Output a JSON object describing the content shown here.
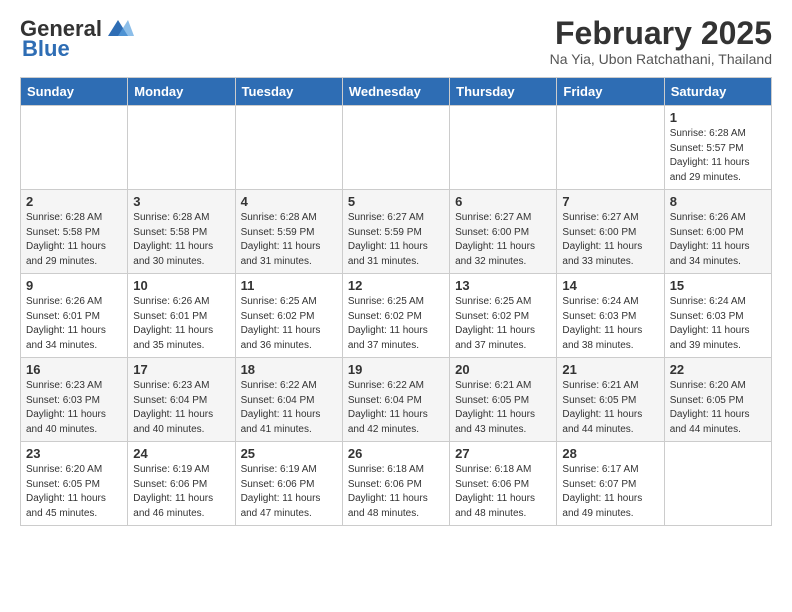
{
  "header": {
    "logo_general": "General",
    "logo_blue": "Blue",
    "month_title": "February 2025",
    "location": "Na Yia, Ubon Ratchathani, Thailand"
  },
  "weekdays": [
    "Sunday",
    "Monday",
    "Tuesday",
    "Wednesday",
    "Thursday",
    "Friday",
    "Saturday"
  ],
  "weeks": [
    [
      {
        "day": "",
        "info": ""
      },
      {
        "day": "",
        "info": ""
      },
      {
        "day": "",
        "info": ""
      },
      {
        "day": "",
        "info": ""
      },
      {
        "day": "",
        "info": ""
      },
      {
        "day": "",
        "info": ""
      },
      {
        "day": "1",
        "info": "Sunrise: 6:28 AM\nSunset: 5:57 PM\nDaylight: 11 hours and 29 minutes."
      }
    ],
    [
      {
        "day": "2",
        "info": "Sunrise: 6:28 AM\nSunset: 5:58 PM\nDaylight: 11 hours and 29 minutes."
      },
      {
        "day": "3",
        "info": "Sunrise: 6:28 AM\nSunset: 5:58 PM\nDaylight: 11 hours and 30 minutes."
      },
      {
        "day": "4",
        "info": "Sunrise: 6:28 AM\nSunset: 5:59 PM\nDaylight: 11 hours and 31 minutes."
      },
      {
        "day": "5",
        "info": "Sunrise: 6:27 AM\nSunset: 5:59 PM\nDaylight: 11 hours and 31 minutes."
      },
      {
        "day": "6",
        "info": "Sunrise: 6:27 AM\nSunset: 6:00 PM\nDaylight: 11 hours and 32 minutes."
      },
      {
        "day": "7",
        "info": "Sunrise: 6:27 AM\nSunset: 6:00 PM\nDaylight: 11 hours and 33 minutes."
      },
      {
        "day": "8",
        "info": "Sunrise: 6:26 AM\nSunset: 6:00 PM\nDaylight: 11 hours and 34 minutes."
      }
    ],
    [
      {
        "day": "9",
        "info": "Sunrise: 6:26 AM\nSunset: 6:01 PM\nDaylight: 11 hours and 34 minutes."
      },
      {
        "day": "10",
        "info": "Sunrise: 6:26 AM\nSunset: 6:01 PM\nDaylight: 11 hours and 35 minutes."
      },
      {
        "day": "11",
        "info": "Sunrise: 6:25 AM\nSunset: 6:02 PM\nDaylight: 11 hours and 36 minutes."
      },
      {
        "day": "12",
        "info": "Sunrise: 6:25 AM\nSunset: 6:02 PM\nDaylight: 11 hours and 37 minutes."
      },
      {
        "day": "13",
        "info": "Sunrise: 6:25 AM\nSunset: 6:02 PM\nDaylight: 11 hours and 37 minutes."
      },
      {
        "day": "14",
        "info": "Sunrise: 6:24 AM\nSunset: 6:03 PM\nDaylight: 11 hours and 38 minutes."
      },
      {
        "day": "15",
        "info": "Sunrise: 6:24 AM\nSunset: 6:03 PM\nDaylight: 11 hours and 39 minutes."
      }
    ],
    [
      {
        "day": "16",
        "info": "Sunrise: 6:23 AM\nSunset: 6:03 PM\nDaylight: 11 hours and 40 minutes."
      },
      {
        "day": "17",
        "info": "Sunrise: 6:23 AM\nSunset: 6:04 PM\nDaylight: 11 hours and 40 minutes."
      },
      {
        "day": "18",
        "info": "Sunrise: 6:22 AM\nSunset: 6:04 PM\nDaylight: 11 hours and 41 minutes."
      },
      {
        "day": "19",
        "info": "Sunrise: 6:22 AM\nSunset: 6:04 PM\nDaylight: 11 hours and 42 minutes."
      },
      {
        "day": "20",
        "info": "Sunrise: 6:21 AM\nSunset: 6:05 PM\nDaylight: 11 hours and 43 minutes."
      },
      {
        "day": "21",
        "info": "Sunrise: 6:21 AM\nSunset: 6:05 PM\nDaylight: 11 hours and 44 minutes."
      },
      {
        "day": "22",
        "info": "Sunrise: 6:20 AM\nSunset: 6:05 PM\nDaylight: 11 hours and 44 minutes."
      }
    ],
    [
      {
        "day": "23",
        "info": "Sunrise: 6:20 AM\nSunset: 6:05 PM\nDaylight: 11 hours and 45 minutes."
      },
      {
        "day": "24",
        "info": "Sunrise: 6:19 AM\nSunset: 6:06 PM\nDaylight: 11 hours and 46 minutes."
      },
      {
        "day": "25",
        "info": "Sunrise: 6:19 AM\nSunset: 6:06 PM\nDaylight: 11 hours and 47 minutes."
      },
      {
        "day": "26",
        "info": "Sunrise: 6:18 AM\nSunset: 6:06 PM\nDaylight: 11 hours and 48 minutes."
      },
      {
        "day": "27",
        "info": "Sunrise: 6:18 AM\nSunset: 6:06 PM\nDaylight: 11 hours and 48 minutes."
      },
      {
        "day": "28",
        "info": "Sunrise: 6:17 AM\nSunset: 6:07 PM\nDaylight: 11 hours and 49 minutes."
      },
      {
        "day": "",
        "info": ""
      }
    ]
  ]
}
